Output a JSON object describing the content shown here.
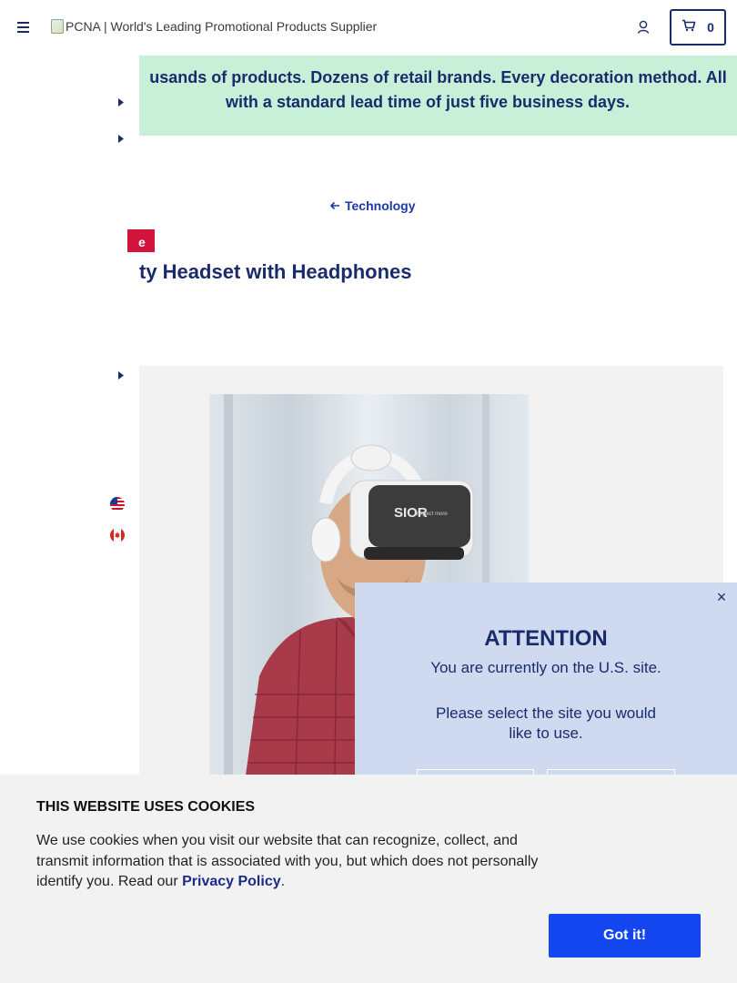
{
  "header": {
    "logo_alt": "PCNA | World's Leading Promotional Products Supplier",
    "cart_count": "0"
  },
  "banner": {
    "line1": "usands of products. Dozens of retail brands. Every decoration method. All",
    "line2": "with a standard lead time of just five business days.",
    "color": "#c8efd8"
  },
  "breadcrumb": {
    "back_label": "Technology"
  },
  "product": {
    "badge": "e",
    "title": "ty Headset with Headphones",
    "headset_brand": "SIOR",
    "headset_tagline": "Expect more"
  },
  "modal": {
    "title": "ATTENTION",
    "line1": "You are currently on the U.S. site.",
    "line2": "Please select the site you would like to use.",
    "close_glyph": "×",
    "background": "#cfdaf0"
  },
  "cookie": {
    "title": "THIS WEBSITE USES COOKIES",
    "text_before": "We use cookies when you visit our website that can recognize, collect, and transmit information that is associated with you, but which does not personally identify you. Read our ",
    "link": "Privacy Policy",
    "text_after": ".",
    "accept_label": "Got it!",
    "accent": "#1446f0"
  },
  "icons": {
    "menu": "hamburger-icon",
    "account": "user-icon",
    "cart": "cart-icon",
    "back": "arrow-left-icon",
    "flags": [
      "us-flag-icon",
      "ca-flag-icon"
    ]
  },
  "colors": {
    "navy": "#1a2b6b",
    "badge_red": "#d2143c",
    "link_blue": "#1a3aa8"
  }
}
